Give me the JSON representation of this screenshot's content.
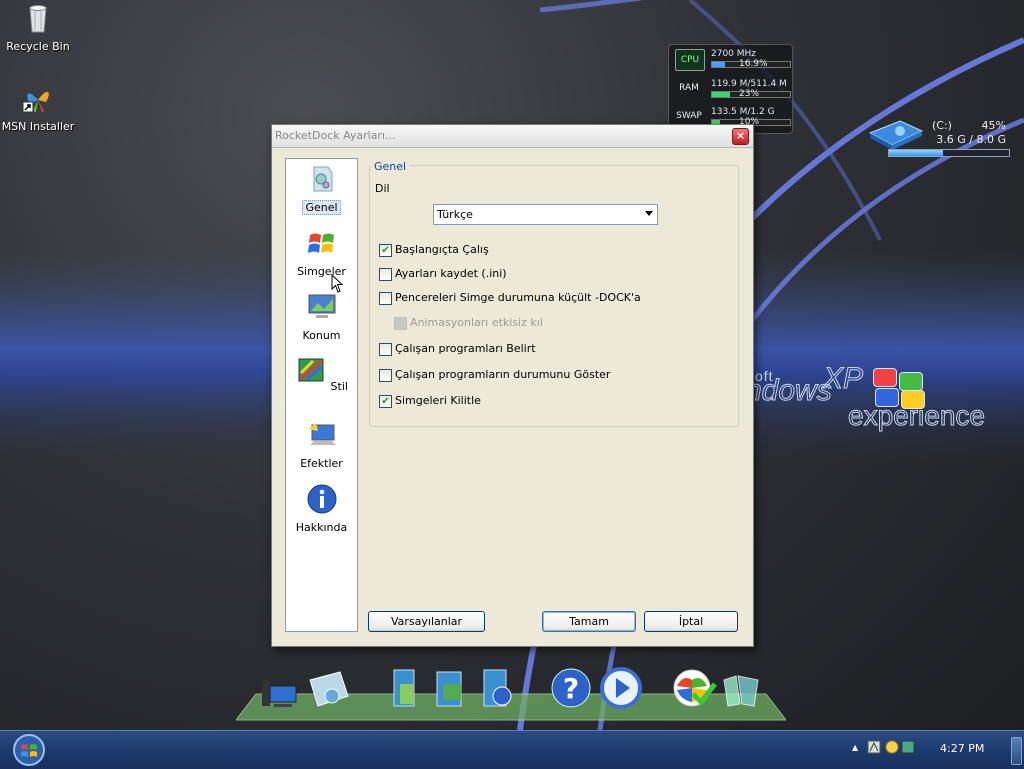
{
  "desktop": {
    "icons": [
      {
        "label": "Recycle Bin"
      },
      {
        "label": "MSN Installer"
      }
    ],
    "wallpaper_text": {
      "word1": "soft",
      "word2": "ndows",
      "word3": "XP",
      "word4": "experience"
    }
  },
  "sysmon": {
    "cpu": {
      "label": "CPU",
      "value": "2700 MHz",
      "pct": "16.9%",
      "fill": 0.169
    },
    "ram": {
      "label": "RAM",
      "value": "119.9 M/511.4 M",
      "pct": "23%",
      "fill": 0.23
    },
    "swap": {
      "label": "SWAP",
      "value": "133.5 M/1.2 G",
      "pct": "10%",
      "fill": 0.1
    }
  },
  "drive": {
    "name": "(C:)",
    "pct": "45%",
    "size": "3.6 G / 8.0 G",
    "fill": 0.45
  },
  "dialog": {
    "title": "RocketDock Ayarları...",
    "close": "×",
    "nav": [
      {
        "label": "Genel",
        "icon": "general-icon"
      },
      {
        "label": "Simgeler",
        "icon": "windows-flag-icon"
      },
      {
        "label": "Konum",
        "icon": "monitor-icon"
      },
      {
        "label": "Stil",
        "icon": "style-icon"
      },
      {
        "label": "Efektler",
        "icon": "effects-icon"
      },
      {
        "label": "Hakkında",
        "icon": "info-icon"
      }
    ],
    "group_title": "Genel",
    "lang_label": "Dil",
    "lang_value": "Türkçe",
    "options": [
      {
        "label": "Başlangıçta Çalış",
        "checked": true
      },
      {
        "label": "Ayarları kaydet (.ini)",
        "checked": false
      },
      {
        "label": "Pencereleri Simge durumuna küçült -DOCK'a",
        "checked": false
      },
      {
        "label": "Animasyonları etkisiz kıl",
        "checked": false,
        "disabled": true
      },
      {
        "label": "Çalışan programları Belirt",
        "checked": false
      },
      {
        "label": "Çalışan programların durumunu Göster",
        "checked": false
      },
      {
        "label": "Simgeleri Kilitle",
        "checked": true
      }
    ],
    "buttons": {
      "defaults": "Varsayılanlar",
      "ok": "Tamam",
      "cancel": "İptal"
    }
  },
  "taskbar": {
    "clock": "4:27 PM",
    "tray_arrow": "▲"
  }
}
